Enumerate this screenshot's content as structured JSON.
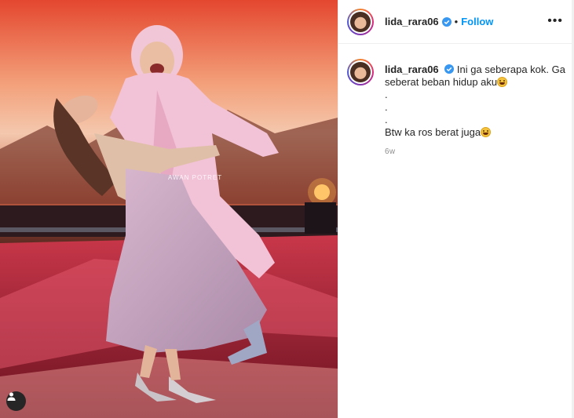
{
  "post": {
    "author": "lida_rara06",
    "follow_label": "Follow",
    "separator": "•",
    "more_label": "•••",
    "watermark": "AWAN POTRET",
    "caption": {
      "author": "lida_rara06",
      "line1": "Ini ga seberapa kok. Ga seberat beban hidup aku",
      "dots": [
        ".",
        ".",
        "."
      ],
      "line2": "Btw ka ros berat juga",
      "time_ago": "6w"
    }
  },
  "colors": {
    "accent": "#0095f6",
    "text": "#262626",
    "muted": "#8e8e8e"
  },
  "icons": [
    "verified-badge-icon",
    "more-options-icon",
    "user-tag-icon",
    "grinning-emoji-icon"
  ]
}
